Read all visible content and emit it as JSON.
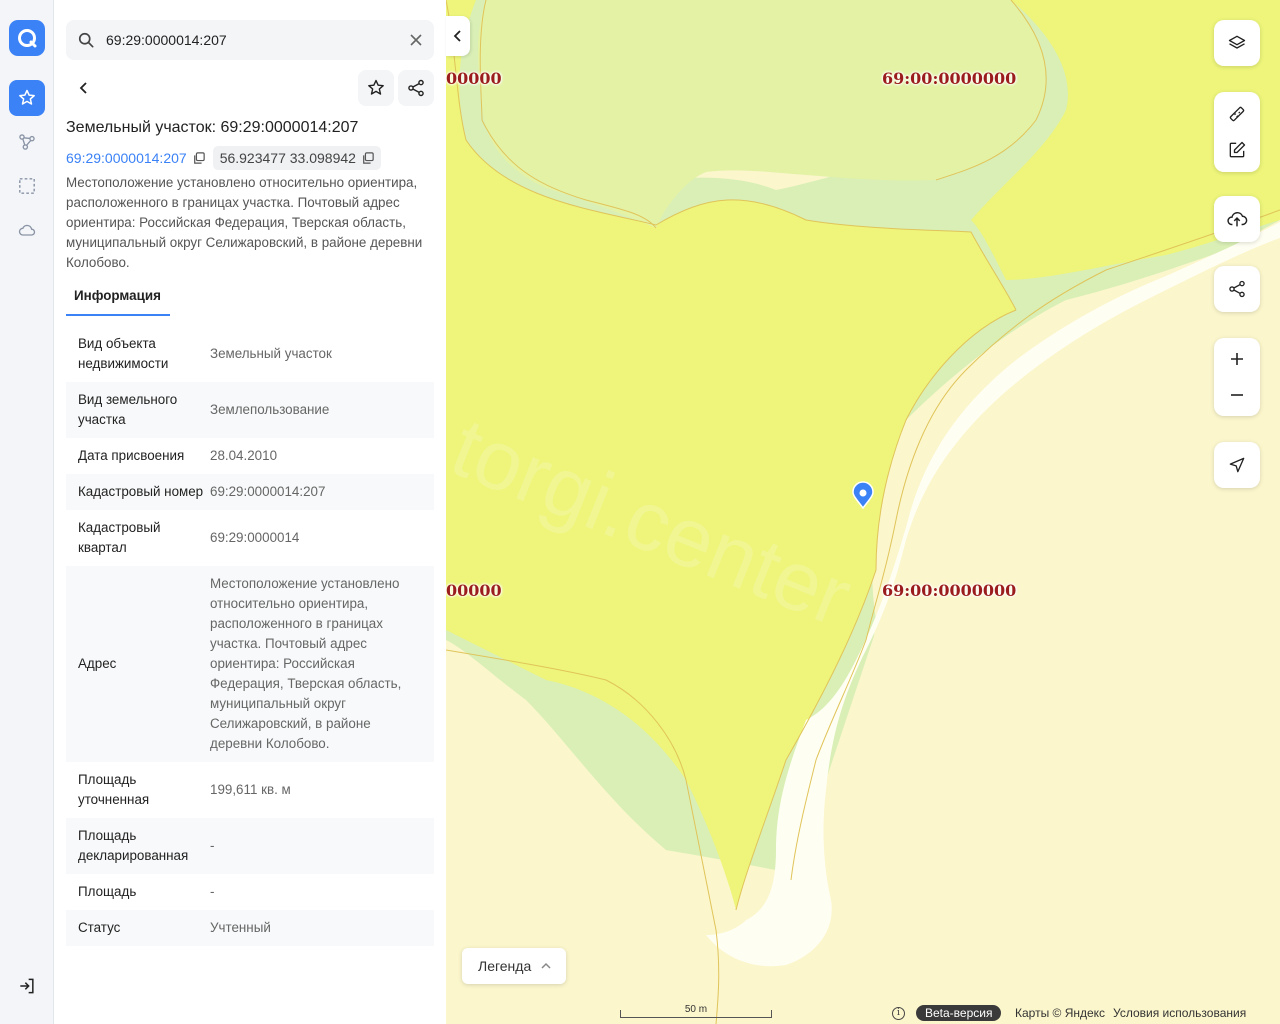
{
  "search": {
    "value": "69:29:0000014:207"
  },
  "object": {
    "title": "Земельный участок: 69:29:0000014:207",
    "cadastral_link": "69:29:0000014:207",
    "coordinates": "56.923477 33.098942",
    "description": "Местоположение установлено относительно ориентира, расположенного в границах участка. Почтовый адрес ориентира: Российская Федерация, Тверская область, муниципальный округ Селижаровский, в районе деревни Колобово."
  },
  "tabs": {
    "info": "Информация"
  },
  "info_rows": [
    {
      "key": "Вид объекта недвижимости",
      "value": "Земельный участок"
    },
    {
      "key": "Вид земельного участка",
      "value": "Землепользование"
    },
    {
      "key": "Дата присвоения",
      "value": "28.04.2010"
    },
    {
      "key": "Кадастровый номер",
      "value": "69:29:0000014:207"
    },
    {
      "key": "Кадастровый квартал",
      "value": "69:29:0000014"
    },
    {
      "key": "Адрес",
      "value": "Местоположение установлено относительно ориентира, расположенного в границах участка. Почтовый адрес ориентира: Российская Федерация, Тверская область, муниципальный округ Селижаровский, в районе деревни Колобово."
    },
    {
      "key": "Площадь уточненная",
      "value": "199,611 кв. м"
    },
    {
      "key": "Площадь декларированная",
      "value": "-"
    },
    {
      "key": "Площадь",
      "value": "-"
    },
    {
      "key": "Статус",
      "value": "Учтенный"
    }
  ],
  "map": {
    "quarter_labels": [
      "00000",
      "69:00:0000000",
      "00000",
      "69:00:0000000"
    ],
    "watermark": "torgi.center",
    "legend_label": "Легенда",
    "scale_label": "50 m",
    "beta_label": "Beta-версия",
    "provider": "Карты © Яндекс",
    "terms": "Условия использования",
    "info_symbol": "i"
  },
  "colors": {
    "accent": "#3b82f6",
    "label": "#9b1c1c",
    "parcel_yellow": "#eef57a",
    "forest_green": "#d9efb6"
  },
  "icons": {
    "rail": [
      "logo-icon",
      "star-icon",
      "route-icon",
      "selection-icon",
      "cloud-icon",
      "logout-icon"
    ],
    "map_controls": [
      "layers-icon",
      "ruler-icon",
      "edit-icon",
      "upload-icon",
      "share-icon",
      "zoom-in-icon",
      "zoom-out-icon",
      "locate-icon"
    ]
  }
}
